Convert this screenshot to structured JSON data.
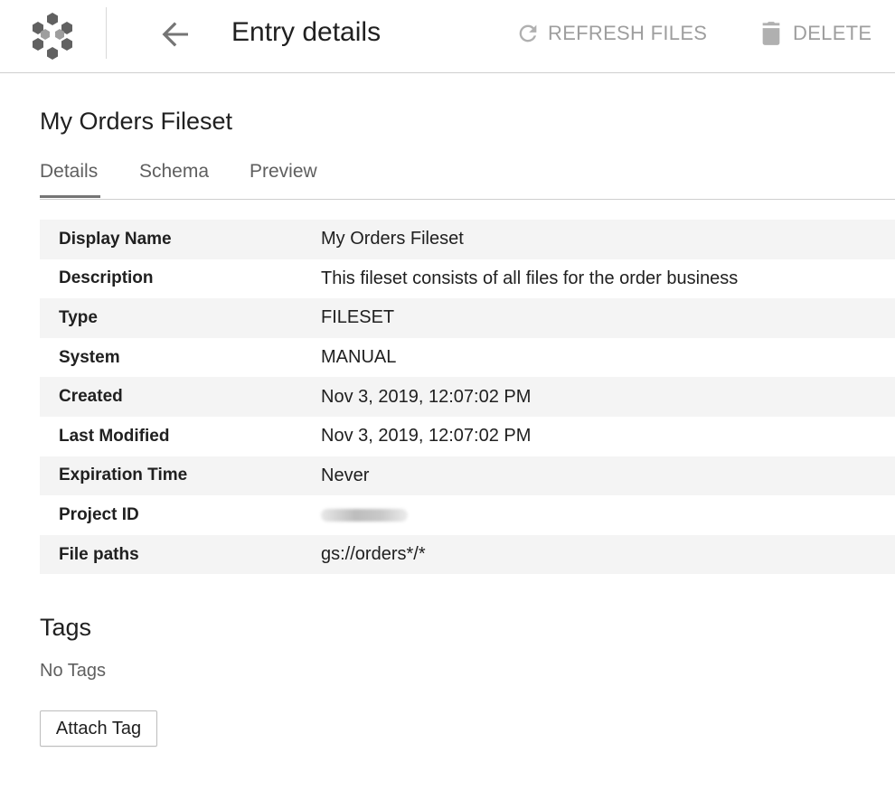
{
  "header": {
    "title": "Entry details",
    "refresh_label": "REFRESH FILES",
    "delete_label": "DELETE"
  },
  "entry": {
    "name": "My Orders Fileset"
  },
  "tabs": [
    {
      "label": "Details",
      "active": true
    },
    {
      "label": "Schema",
      "active": false
    },
    {
      "label": "Preview",
      "active": false
    }
  ],
  "details": [
    {
      "key": "Display Name",
      "value": "My Orders Fileset"
    },
    {
      "key": "Description",
      "value": "This fileset consists of all files for the order business"
    },
    {
      "key": "Type",
      "value": "FILESET"
    },
    {
      "key": "System",
      "value": "MANUAL"
    },
    {
      "key": "Created",
      "value": "Nov 3, 2019, 12:07:02 PM"
    },
    {
      "key": "Last Modified",
      "value": "Nov 3, 2019, 12:07:02 PM"
    },
    {
      "key": "Expiration Time",
      "value": "Never"
    },
    {
      "key": "Project ID",
      "value": ""
    },
    {
      "key": "File paths",
      "value": "gs://orders*/*"
    }
  ],
  "tags": {
    "title": "Tags",
    "empty_text": "No Tags",
    "attach_label": "Attach Tag"
  },
  "colors": {
    "disabled_text": "#9e9e9e",
    "row_stripe": "#f4f4f4",
    "divider": "#cfcfcf"
  },
  "icons": {
    "logo": "data-catalog-hexagon-icon",
    "back": "arrow-back-icon",
    "refresh": "refresh-icon",
    "delete": "trash-icon"
  }
}
